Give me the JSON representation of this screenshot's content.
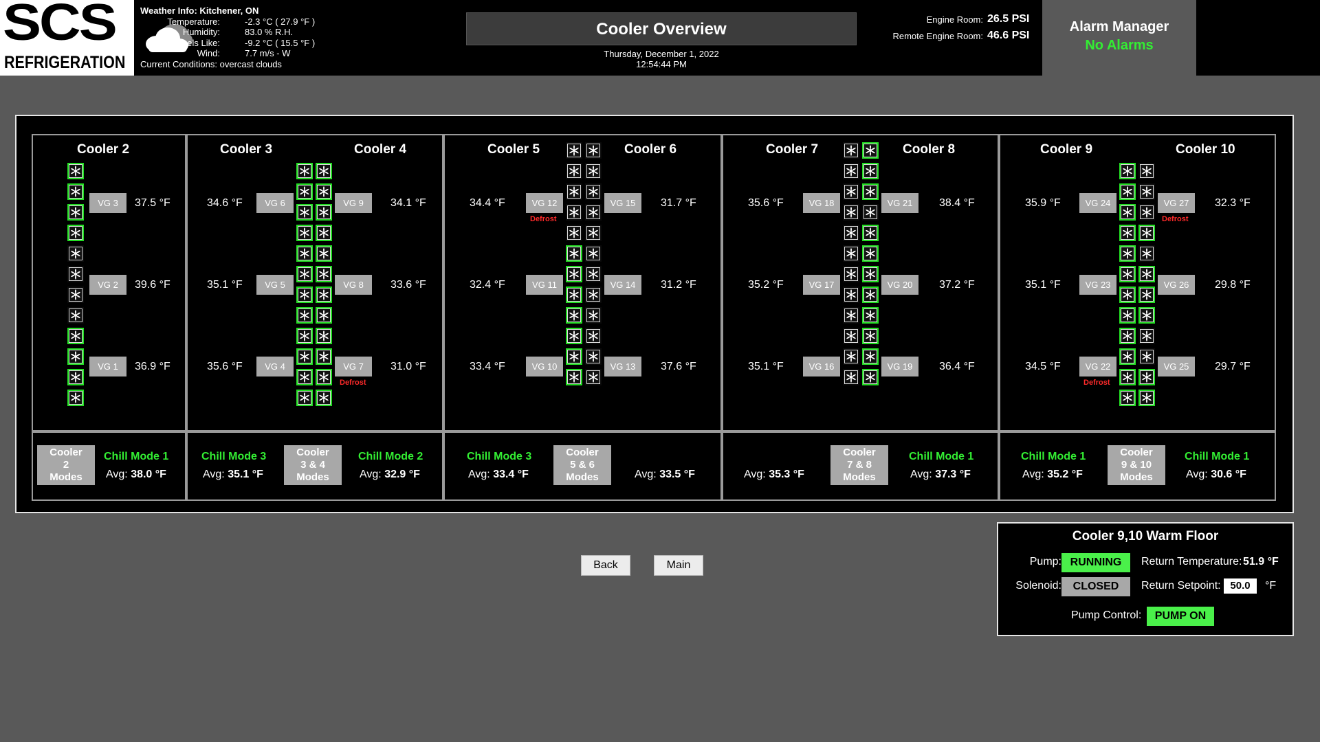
{
  "header": {
    "logo_top": "SCS",
    "logo_bottom": "REFRIGERATION",
    "weather": {
      "title": "Weather Info: Kitchener, ON",
      "rows": [
        {
          "label": "Temperature:",
          "value": "-2.3 °C ( 27.9 °F )"
        },
        {
          "label": "Humidity:",
          "value": "83.0 % R.H."
        },
        {
          "label": "Feels Like:",
          "value": "-9.2 °C ( 15.5 °F )"
        },
        {
          "label": "Wind:",
          "value": "7.7 m/s - W"
        }
      ],
      "conditions": "Current Conditions: overcast clouds",
      "icon": "cloud-icon"
    },
    "title": "Cooler Overview",
    "date": "Thursday, December 1, 2022",
    "time": "12:54:44 PM",
    "pressure": [
      {
        "label": "Engine Room:",
        "value": "26.5 PSI"
      },
      {
        "label": "Remote Engine Room:",
        "value": "46.6 PSI"
      }
    ],
    "alarm": {
      "title": "Alarm Manager",
      "status": "No Alarms"
    }
  },
  "sections": [
    {
      "coolers": [
        "Cooler 2"
      ],
      "vgs": [
        {
          "label": "VG 3",
          "temp": "37.5 °F",
          "defrost": ""
        },
        {
          "label": "VG 2",
          "temp": "39.6 °F",
          "defrost": ""
        },
        {
          "label": "VG 1",
          "temp": "36.9 °F",
          "defrost": ""
        }
      ],
      "modes": {
        "button": [
          "Cooler",
          "2",
          "Modes"
        ],
        "chill": "Chill Mode 1",
        "avg_label": "Avg:",
        "avg": "38.0 °F"
      }
    },
    {
      "coolers": [
        "Cooler 3",
        "Cooler 4"
      ],
      "left": [
        {
          "label": "VG 6",
          "temp": "34.6 °F",
          "defrost": ""
        },
        {
          "label": "VG 5",
          "temp": "35.1 °F",
          "defrost": ""
        },
        {
          "label": "VG 4",
          "temp": "35.6 °F",
          "defrost": ""
        }
      ],
      "right": [
        {
          "label": "VG 9",
          "temp": "34.1 °F",
          "defrost": ""
        },
        {
          "label": "VG 8",
          "temp": "33.6 °F",
          "defrost": ""
        },
        {
          "label": "VG 7",
          "temp": "31.0 °F",
          "defrost": "Defrost"
        }
      ],
      "modes": {
        "button": [
          "Cooler",
          "3 & 4",
          "Modes"
        ],
        "left_chill": "Chill Mode 3",
        "left_avg": "35.1 °F",
        "right_chill": "Chill Mode 2",
        "right_avg": "32.9 °F",
        "avg_label": "Avg:"
      }
    },
    {
      "coolers": [
        "Cooler 5",
        "Cooler 6"
      ],
      "left": [
        {
          "label": "VG 12",
          "temp": "34.4 °F",
          "defrost": "Defrost"
        },
        {
          "label": "VG 11",
          "temp": "32.4 °F",
          "defrost": ""
        },
        {
          "label": "VG 10",
          "temp": "33.4 °F",
          "defrost": ""
        }
      ],
      "right": [
        {
          "label": "VG 15",
          "temp": "31.7 °F",
          "defrost": ""
        },
        {
          "label": "VG 14",
          "temp": "31.2 °F",
          "defrost": ""
        },
        {
          "label": "VG 13",
          "temp": "37.6 °F",
          "defrost": ""
        }
      ],
      "modes": {
        "button": [
          "Cooler",
          "5 & 6",
          "Modes"
        ],
        "left_chill": "Chill Mode 3",
        "left_avg": "33.4 °F",
        "right_chill": "",
        "right_avg": "33.5 °F",
        "avg_label": "Avg:"
      }
    },
    {
      "coolers": [
        "Cooler 7",
        "Cooler 8"
      ],
      "left": [
        {
          "label": "VG 18",
          "temp": "35.6 °F",
          "defrost": ""
        },
        {
          "label": "VG 17",
          "temp": "35.2 °F",
          "defrost": ""
        },
        {
          "label": "VG 16",
          "temp": "35.1 °F",
          "defrost": ""
        }
      ],
      "right": [
        {
          "label": "VG 21",
          "temp": "38.4 °F",
          "defrost": ""
        },
        {
          "label": "VG 20",
          "temp": "37.2 °F",
          "defrost": ""
        },
        {
          "label": "VG 19",
          "temp": "36.4 °F",
          "defrost": ""
        }
      ],
      "modes": {
        "button": [
          "Cooler",
          "7 & 8",
          "Modes"
        ],
        "left_chill": "",
        "left_avg": "35.3 °F",
        "right_chill": "Chill Mode 1",
        "right_avg": "37.3 °F",
        "avg_label": "Avg:"
      }
    },
    {
      "coolers": [
        "Cooler 9",
        "Cooler 10"
      ],
      "left": [
        {
          "label": "VG 24",
          "temp": "35.9 °F",
          "defrost": ""
        },
        {
          "label": "VG 23",
          "temp": "35.1 °F",
          "defrost": ""
        },
        {
          "label": "VG 22",
          "temp": "34.5 °F",
          "defrost": "Defrost"
        }
      ],
      "right": [
        {
          "label": "VG 27",
          "temp": "32.3 °F",
          "defrost": "Defrost"
        },
        {
          "label": "VG 26",
          "temp": "29.8 °F",
          "defrost": ""
        },
        {
          "label": "VG 25",
          "temp": "29.7 °F",
          "defrost": ""
        }
      ],
      "modes": {
        "button": [
          "Cooler",
          "9 & 10",
          "Modes"
        ],
        "left_chill": "Chill Mode 1",
        "left_avg": "35.2 °F",
        "right_chill": "Chill Mode 1",
        "right_avg": "30.6 °F",
        "avg_label": "Avg:"
      }
    }
  ],
  "fan_columns": [
    [
      1,
      1,
      1,
      1,
      0,
      0,
      0,
      0,
      1,
      1,
      1,
      1
    ],
    [
      1,
      1,
      1,
      1,
      1,
      1,
      1,
      1,
      1,
      1,
      1,
      1
    ],
    [
      1,
      1,
      1,
      1,
      1,
      1,
      1,
      1,
      1,
      1,
      1,
      1
    ],
    [
      0,
      0,
      0,
      0,
      0,
      1,
      1,
      1,
      1,
      1,
      1,
      1
    ],
    [
      0,
      0,
      0,
      0,
      0,
      0,
      0,
      0,
      0,
      0,
      0,
      0
    ],
    [
      0,
      0,
      0,
      0,
      0,
      0,
      0,
      0,
      0,
      0,
      0,
      0
    ],
    [
      1,
      1,
      1,
      0,
      1,
      1,
      1,
      1,
      1,
      1,
      1,
      1
    ],
    [
      1,
      1,
      1,
      1,
      1,
      1,
      1,
      1,
      1,
      1,
      1,
      1
    ],
    [
      0,
      0,
      0,
      1,
      0,
      1,
      1,
      1,
      0,
      0,
      1,
      1
    ]
  ],
  "nav": {
    "back": "Back",
    "main": "Main"
  },
  "warm_floor": {
    "title": "Cooler 9,10 Warm Floor",
    "pump_label": "Pump:",
    "pump_status": "RUNNING",
    "solenoid_label": "Solenoid:",
    "solenoid_status": "CLOSED",
    "return_temp_label": "Return Temperature:",
    "return_temp": "51.9 °F",
    "setpoint_label": "Return Setpoint:",
    "setpoint": "50.0",
    "setpoint_unit": "°F",
    "pump_control_label": "Pump Control:",
    "pump_control": "PUMP ON"
  },
  "colors": {
    "accent_green": "#33ee33",
    "fan_on": "#22dd22",
    "defrost": "#ff2a2a",
    "background": "#595959"
  }
}
